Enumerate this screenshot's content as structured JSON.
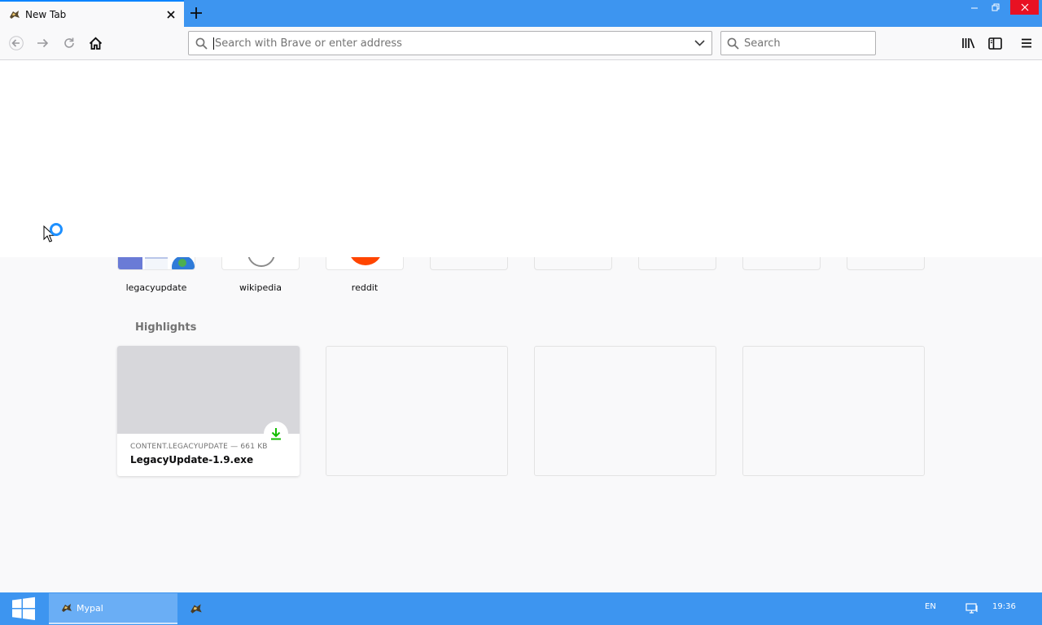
{
  "tab": {
    "title": "New Tab"
  },
  "urlbar": {
    "placeholder": "Search with Brave or enter address"
  },
  "searchbar": {
    "placeholder": "Search"
  },
  "top_sites": [
    {
      "label": "legacyupdate"
    },
    {
      "label": "wikipedia"
    },
    {
      "label": "reddit"
    }
  ],
  "highlights": {
    "title": "Highlights",
    "items": [
      {
        "meta": "CONTENT.LEGACYUPDATE — 661 KB",
        "name": "LegacyUpdate-1.9.exe"
      }
    ]
  },
  "taskbar": {
    "task_label": "Mypal",
    "language": "EN",
    "clock": "19:36"
  },
  "colors": {
    "titlebar": "#3d95f0",
    "accent": "#0a84ff",
    "download_green": "#12bc00",
    "reddit": "#ff4500",
    "close_red": "#e81123"
  },
  "icons": [
    "back-icon",
    "forward-icon",
    "reload-icon",
    "home-icon",
    "search-icon",
    "chevron-down-icon",
    "library-icon",
    "sidebar-icon",
    "menu-icon",
    "download-icon",
    "windows-logo-icon",
    "network-icon",
    "mypal-icon"
  ]
}
